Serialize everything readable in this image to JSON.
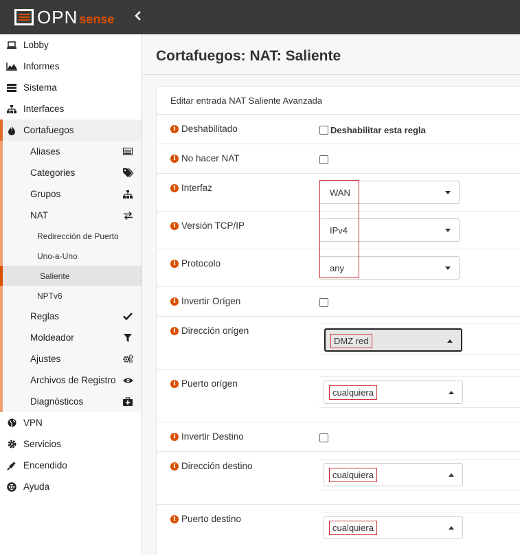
{
  "brand": {
    "opn": "OPN",
    "sense": "sense"
  },
  "sidebar": {
    "items": [
      {
        "label": "Lobby",
        "icon": "laptop-icon"
      },
      {
        "label": "Informes",
        "icon": "area-chart-icon"
      },
      {
        "label": "Sistema",
        "icon": "server-icon"
      },
      {
        "label": "Interfaces",
        "icon": "sitemap-icon"
      },
      {
        "label": "Cortafuegos",
        "icon": "fire-icon"
      }
    ],
    "firewall_sub": [
      {
        "label": "Aliases",
        "icon": "list-alt-icon"
      },
      {
        "label": "Categories",
        "icon": "tags-icon"
      },
      {
        "label": "Grupos",
        "icon": "sitemap-icon"
      },
      {
        "label": "NAT",
        "icon": "exchange-icon"
      }
    ],
    "nat_sub": [
      {
        "label": "Redirección de Puerto"
      },
      {
        "label": "Uno-a-Uno"
      },
      {
        "label": "Saliente"
      },
      {
        "label": "NPTv6"
      }
    ],
    "firewall_sub2": [
      {
        "label": "Reglas",
        "icon": "check-icon"
      },
      {
        "label": "Moldeador",
        "icon": "filter-icon"
      },
      {
        "label": "Ajustes",
        "icon": "cogs-icon"
      },
      {
        "label": "Archivos de Registro",
        "icon": "eye-icon"
      },
      {
        "label": "Diagnósticos",
        "icon": "medkit-icon"
      }
    ],
    "bottom": [
      {
        "label": "VPN",
        "icon": "globe-icon"
      },
      {
        "label": "Servicios",
        "icon": "cog-icon"
      },
      {
        "label": "Encendido",
        "icon": "plug-icon"
      },
      {
        "label": "Ayuda",
        "icon": "life-ring-icon"
      }
    ]
  },
  "page": {
    "title": "Cortafuegos: NAT: Saliente",
    "panel_title": "Editar entrada NAT Saliente Avanzada"
  },
  "form": {
    "disabled": {
      "label": "Deshabilitado",
      "checkbox_label": "Deshabilitar esta regla"
    },
    "no_nat": {
      "label": "No hacer NAT"
    },
    "interface": {
      "label": "Interfaz",
      "value": "WAN"
    },
    "tcpip_version": {
      "label": "Versión TCP/IP",
      "value": "IPv4"
    },
    "protocol": {
      "label": "Protocolo",
      "value": "any"
    },
    "invert_source": {
      "label": "Invertir Orígen"
    },
    "source_address": {
      "label": "Dirección orígen",
      "value": "DMZ red"
    },
    "source_port": {
      "label": "Puerto orígen",
      "value": "cualquiera"
    },
    "invert_destination": {
      "label": "Invertir Destino"
    },
    "destination_address": {
      "label": "Dirección destino",
      "value": "cualquiera"
    },
    "destination_port": {
      "label": "Puerto destino",
      "value": "cualquiera"
    }
  },
  "colors": {
    "accent": "#d94f00",
    "annotation": "#d0303a",
    "topbar": "#3a3a3a"
  }
}
